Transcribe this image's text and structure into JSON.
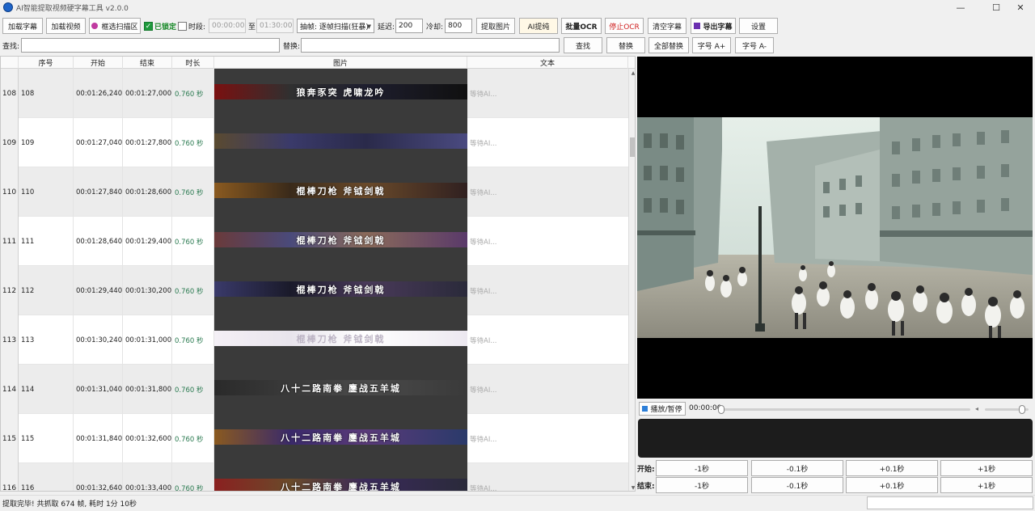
{
  "window": {
    "title": "AI智能提取视频硬字幕工具 v2.0.0",
    "minimize": "—",
    "maximize": "☐",
    "close": "✕"
  },
  "toolbar": {
    "load_subtitle": "加载字幕",
    "load_video": "加载视频",
    "select_scan_area": "框选扫描区",
    "locked_label": "已锁定",
    "period_label": "时段:",
    "start_time": "00:00:00",
    "to_label": "至",
    "end_time": "01:30:00",
    "frame_mode": "抽帧: 逐帧扫描(狂暴)",
    "delay_label": "延迟:",
    "delay_value": "200",
    "cooldown_label": "冷却:",
    "cooldown_value": "800",
    "extract_images": "提取图片",
    "ai_extract": "AI提纯",
    "batch_ocr": "批量OCR",
    "stop_ocr": "停止OCR",
    "clear_subtitles": "清空字幕",
    "export_subtitles": "导出字幕",
    "settings": "设置"
  },
  "search": {
    "find_label": "查找:",
    "find_value": "",
    "replace_label": "替换:",
    "replace_value": "",
    "find_button": "查找",
    "replace_button": "替换",
    "replace_all_button": "全部替换",
    "font_bigger": "字号 A+",
    "font_smaller": "字号 A-"
  },
  "table": {
    "columns": [
      "序号",
      "开始",
      "结束",
      "时长",
      "图片",
      "文本"
    ],
    "rows": [
      {
        "row_header": "108",
        "index": "108",
        "start": "00:01:26,240",
        "end": "00:01:27,000",
        "duration": "0.760 秒",
        "image_text": "狼奔豕突 虎啸龙吟",
        "text": "等待AI..."
      },
      {
        "row_header": "109",
        "index": "109",
        "start": "00:01:27,040",
        "end": "00:01:27,800",
        "duration": "0.760 秒",
        "image_text": "",
        "text": "等待AI..."
      },
      {
        "row_header": "110",
        "index": "110",
        "start": "00:01:27,840",
        "end": "00:01:28,600",
        "duration": "0.760 秒",
        "image_text": "棍棒刀枪 斧钺剑戟",
        "text": "等待AI..."
      },
      {
        "row_header": "111",
        "index": "111",
        "start": "00:01:28,640",
        "end": "00:01:29,400",
        "duration": "0.760 秒",
        "image_text": "棍棒刀枪 斧钺剑戟",
        "text": "等待AI..."
      },
      {
        "row_header": "112",
        "index": "112",
        "start": "00:01:29,440",
        "end": "00:01:30,200",
        "duration": "0.760 秒",
        "image_text": "棍棒刀枪 斧钺剑戟",
        "text": "等待AI..."
      },
      {
        "row_header": "113",
        "index": "113",
        "start": "00:01:30,240",
        "end": "00:01:31,000",
        "duration": "0.760 秒",
        "image_text": "棍棒刀枪 斧钺剑戟",
        "text": "等待AI..."
      },
      {
        "row_header": "114",
        "index": "114",
        "start": "00:01:31,040",
        "end": "00:01:31,800",
        "duration": "0.760 秒",
        "image_text": "八十二路南拳 鏖战五羊城",
        "text": "等待AI..."
      },
      {
        "row_header": "115",
        "index": "115",
        "start": "00:01:31,840",
        "end": "00:01:32,600",
        "duration": "0.760 秒",
        "image_text": "八十二路南拳 鏖战五羊城",
        "text": "等待AI..."
      },
      {
        "row_header": "116",
        "index": "116",
        "start": "00:01:32,640",
        "end": "00:01:33,400",
        "duration": "0.760 秒",
        "image_text": "八十二路南拳 鏖战五羊城",
        "text": "等待AI..."
      }
    ]
  },
  "player": {
    "play_pause": "播放/暂停",
    "current_time": "00:00:00",
    "volume_icon": "speaker-icon"
  },
  "nudge": {
    "start_label": "开始:",
    "end_label": "结束:",
    "buttons": [
      "-1秒",
      "-0.1秒",
      "+0.1秒",
      "+1秒"
    ]
  },
  "status": {
    "message": "提取完毕! 共抓取 674 帧, 耗时 1分 10秒"
  },
  "colors": {
    "accent": "#1e64c8",
    "locked_green": "#1a8a2a",
    "duration_green": "#2a7a50",
    "stop_red": "#d02020"
  }
}
